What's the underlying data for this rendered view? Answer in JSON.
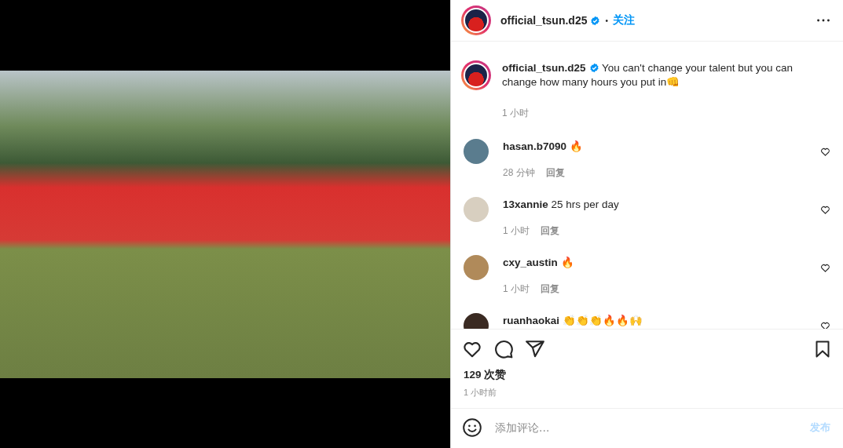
{
  "post": {
    "username": "official_tsun.d25",
    "verified": true,
    "follow": "关注",
    "separator": "•"
  },
  "caption": {
    "username": "official_tsun.d25",
    "verified": true,
    "text": "You can't change your talent but you can change how many hours you put in👊",
    "time": "1 小时"
  },
  "comments": [
    {
      "username": "hasan.b7090",
      "text": "🔥",
      "time": "28 分钟",
      "reply": "回复",
      "liked": false,
      "color": "#5a7c8e"
    },
    {
      "username": "13xannie",
      "text": "25 hrs per day",
      "time": "1 小时",
      "reply": "回复",
      "liked": false,
      "color": "#d8cfc0"
    },
    {
      "username": "cxy_austin",
      "text": "🔥",
      "time": "1 小时",
      "reply": "回复",
      "liked": false,
      "color": "#b08a5a"
    },
    {
      "username": "ruanhaokai",
      "text": "👏👏👏🔥🔥🙌",
      "liked": false,
      "color": "#3a2a22"
    }
  ],
  "likes": "129 次赞",
  "posted": "1 小时前",
  "liked": false,
  "saved": false,
  "comment_box": {
    "placeholder": "添加评论...",
    "submit": "发布"
  }
}
